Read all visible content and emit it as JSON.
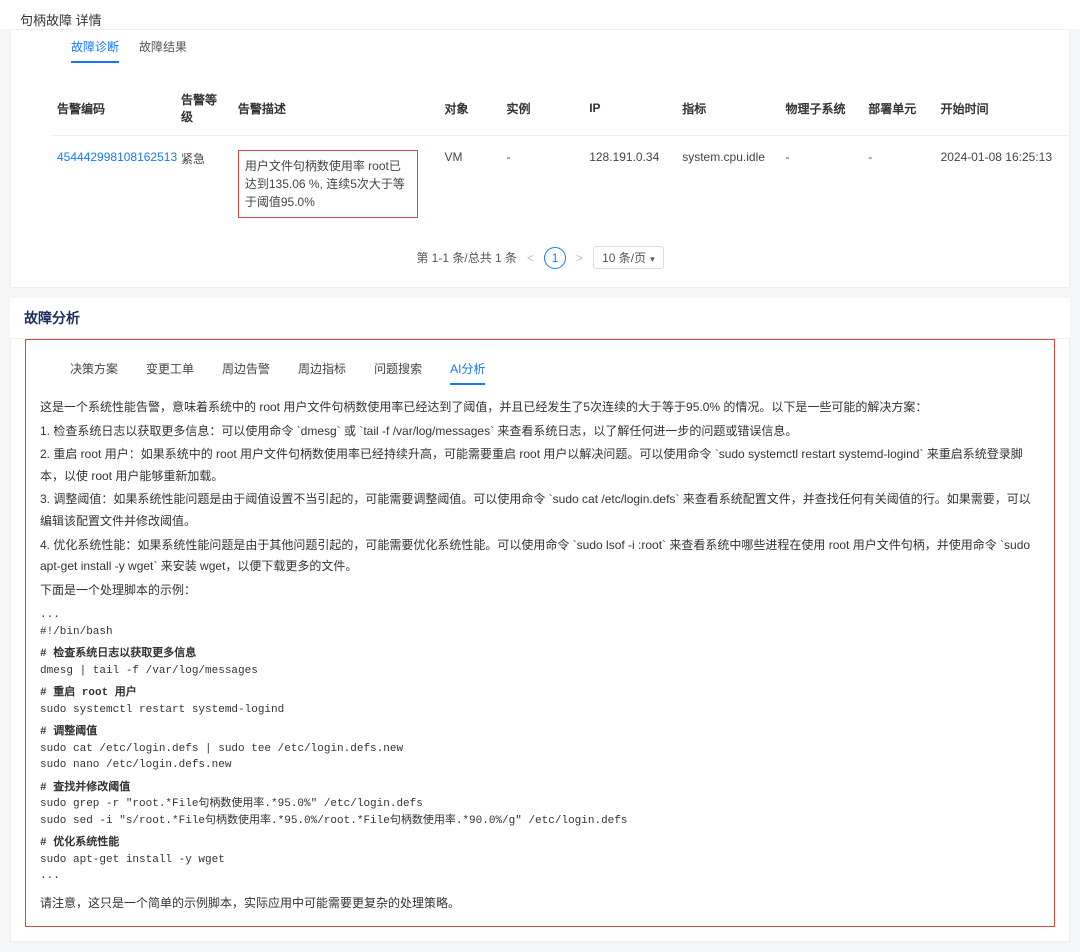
{
  "page_title": "句柄故障 详情",
  "subtabs": {
    "t1": "故障诊断",
    "t2": "故障结果"
  },
  "table": {
    "headers": {
      "id": "告警编码",
      "level": "告警等级",
      "desc": "告警描述",
      "object": "对象",
      "instance": "实例",
      "ip": "IP",
      "metric": "指标",
      "subsystem": "物理子系统",
      "unit": "部署单元",
      "start": "开始时间"
    },
    "row": {
      "id": "454442998108162513",
      "level": "紧急",
      "desc": "用户文件句柄数使用率 root已达到135.06 %, 连续5次大于等于阈值95.0%",
      "object": "VM",
      "instance": "-",
      "ip": "128.191.0.34",
      "metric": "system.cpu.idle",
      "subsystem": "-",
      "unit": "-",
      "start": "2024-01-08 16:25:13"
    }
  },
  "pager": {
    "summary": "第 1-1 条/总共 1 条",
    "current": "1",
    "page_size": "10 条/页"
  },
  "analysis_title": "故障分析",
  "analysis_tabs": {
    "t1": "决策方案",
    "t2": "变更工单",
    "t3": "周边告警",
    "t4": "周边指标",
    "t5": "问题搜索",
    "t6": "AI分析"
  },
  "ai": {
    "intro": "这是一个系统性能告警，意味着系统中的 root 用户文件句柄数使用率已经达到了阈值，并且已经发生了5次连续的大于等于95.0% 的情况。以下是一些可能的解决方案：",
    "p1": "1. 检查系统日志以获取更多信息：可以使用命令 `dmesg` 或 `tail -f /var/log/messages` 来查看系统日志，以了解任何进一步的问题或错误信息。",
    "p2": "2. 重启 root 用户：如果系统中的 root 用户文件句柄数使用率已经持续升高，可能需要重启 root 用户以解决问题。可以使用命令 `sudo systemctl restart systemd-logind` 来重启系统登录脚本，以使 root 用户能够重新加载。",
    "p3": "3. 调整阈值：如果系统性能问题是由于阈值设置不当引起的，可能需要调整阈值。可以使用命令 `sudo cat /etc/login.defs` 来查看系统配置文件，并查找任何有关阈值的行。如果需要，可以编辑该配置文件并修改阈值。",
    "p4": "4. 优化系统性能：如果系统性能问题是由于其他问题引起的，可能需要优化系统性能。可以使用命令 `sudo lsof -i :root` 来查看系统中哪些进程在使用 root 用户文件句柄，并使用命令 `sudo apt-get install -y wget` 来安装 wget，以便下载更多的文件。",
    "p5": "下面是一个处理脚本的示例：",
    "code": {
      "c0": "...",
      "c1": "#!/bin/bash",
      "c2": "# 检查系统日志以获取更多信息",
      "c3": "dmesg | tail -f /var/log/messages",
      "c4": "# 重启 root 用户",
      "c5": "sudo systemctl restart systemd-logind",
      "c6": "# 调整阈值",
      "c7": "sudo cat /etc/login.defs | sudo tee /etc/login.defs.new",
      "c8": "sudo nano /etc/login.defs.new",
      "c9": "# 查找并修改阈值",
      "c10": "sudo grep -r \"root.*File句柄数使用率.*95.0%\" /etc/login.defs",
      "c11": "sudo sed -i \"s/root.*File句柄数使用率.*95.0%/root.*File句柄数使用率.*90.0%/g\" /etc/login.defs",
      "c12": "# 优化系统性能",
      "c13": "sudo apt-get install -y wget",
      "c14": "..."
    },
    "note": "请注意，这只是一个简单的示例脚本，实际应用中可能需要更复杂的处理策略。"
  }
}
